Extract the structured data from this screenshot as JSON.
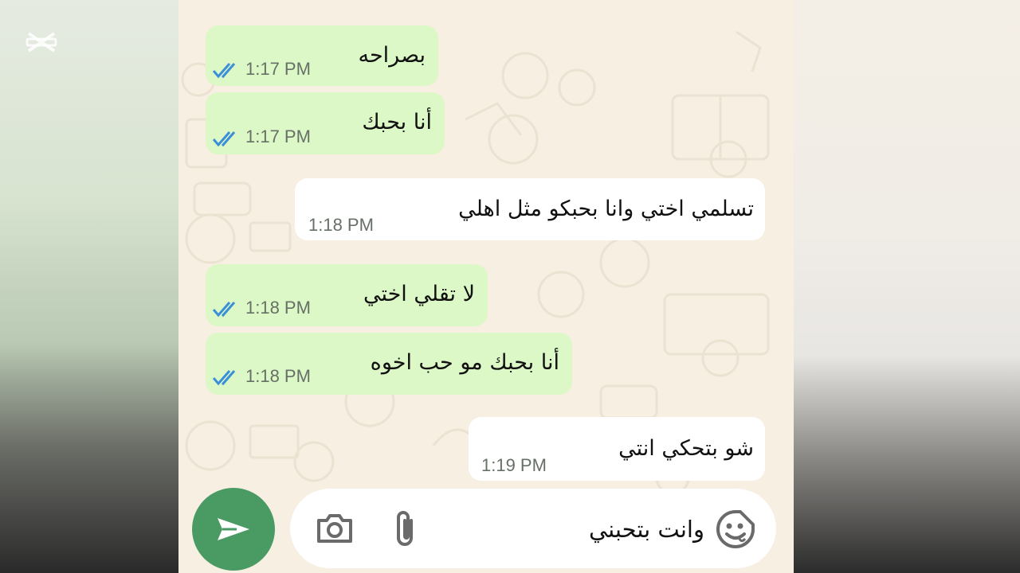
{
  "messages": [
    {
      "direction": "out",
      "text": "بصراحه",
      "time": "1:17 PM",
      "status": "read"
    },
    {
      "direction": "out",
      "text": "أنا بحبك",
      "time": "1:17 PM",
      "status": "read"
    },
    {
      "direction": "in",
      "text": "تسلمي اختي وانا بحبكو مثل اهلي",
      "time": "1:18 PM"
    },
    {
      "direction": "out",
      "text": "لا تقلي اختي",
      "time": "1:18 PM",
      "status": "read"
    },
    {
      "direction": "out",
      "text": "أنا بحبك مو حب اخوه",
      "time": "1:18 PM",
      "status": "read"
    },
    {
      "direction": "in",
      "text": "شو بتحكي انتي",
      "time": "1:19 PM"
    }
  ],
  "composer": {
    "text": "وانت بتحبني",
    "icons": [
      "sticker-icon",
      "attach-icon",
      "camera-icon"
    ],
    "send_icon": "send-icon"
  },
  "colors": {
    "outgoing_bubble": "#dcf8c7",
    "incoming_bubble": "#ffffff",
    "chat_background": "#f6efe2",
    "send_button": "#4a9a64",
    "read_ticks": "#3a8fd8"
  }
}
